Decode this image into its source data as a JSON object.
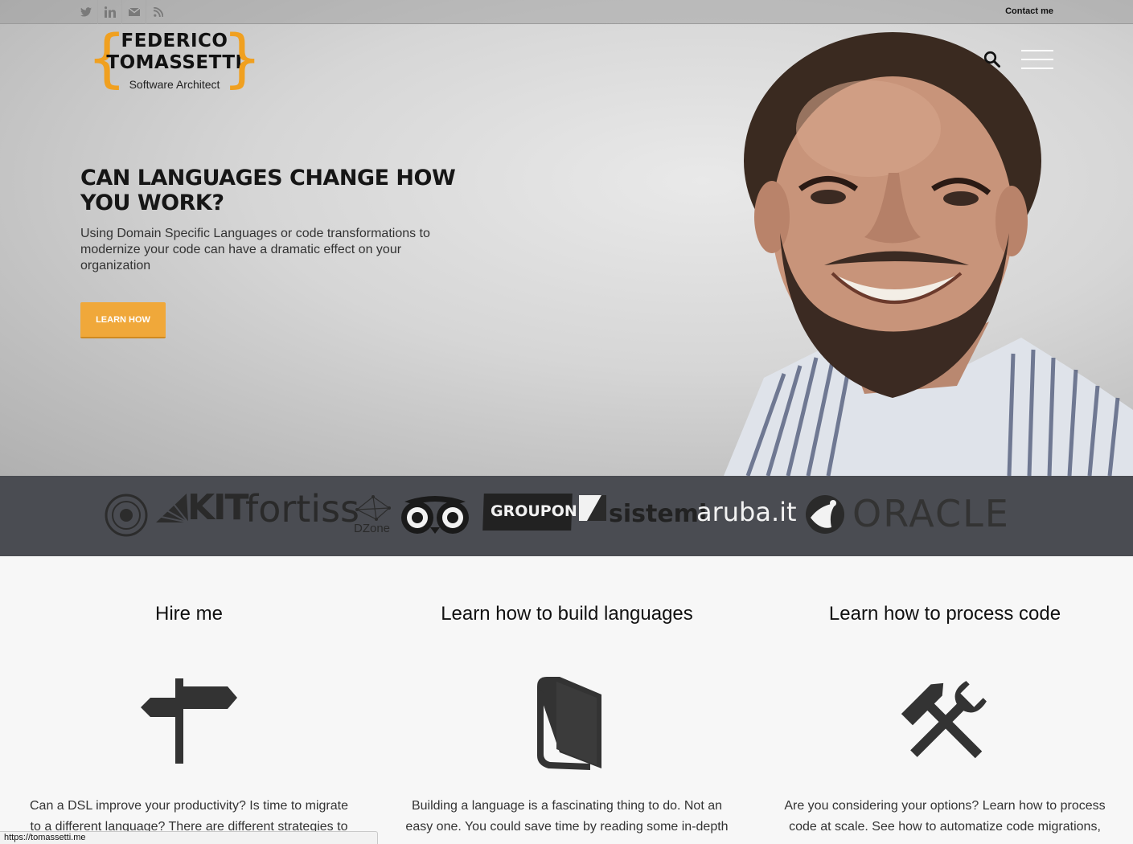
{
  "topbar": {
    "social_icons": [
      "twitter-icon",
      "linkedin-icon",
      "mail-icon",
      "rss-icon"
    ],
    "contact_label": "Contact me"
  },
  "logo": {
    "name_line1": "FEDERICO",
    "name_line2": "TOMASSETTI",
    "tagline": "Software Architect",
    "brace_open": "{",
    "brace_close": "}"
  },
  "hero": {
    "title": "CAN LANGUAGES CHANGE HOW YOU WORK?",
    "text": "Using Domain Specific Languages or code transformations to modernize your code can have a dramatic effect on your organization",
    "cta_label": "LEARN HOW"
  },
  "clients": {
    "kit": "KIT",
    "fortiss": "fortiss",
    "dzone": "DZone",
    "groupon": "GROUPON",
    "sistemi": "sistemi",
    "aruba": "aruba.it",
    "oracle": "ORACLE"
  },
  "services": [
    {
      "title": "Hire me",
      "icon": "signpost-icon",
      "text": "Can a DSL improve your productivity? Is time to migrate to a different language? There are different strategies to"
    },
    {
      "title": "Learn how to build languages",
      "icon": "book-icon",
      "text": "Building a language is a fascinating thing to do. Not an easy one. You could save time by reading some in-depth"
    },
    {
      "title": "Learn how to process code",
      "icon": "tools-icon",
      "text": "Are you considering your options? Learn how to process code at scale. See how to automatize code migrations,"
    }
  ],
  "status_bar": {
    "url": "https://tomassetti.me"
  },
  "colors": {
    "accent": "#f0a83a",
    "brace": "#f0a020",
    "clients_bg": "#4a4c52",
    "icon_dark": "#333333"
  }
}
